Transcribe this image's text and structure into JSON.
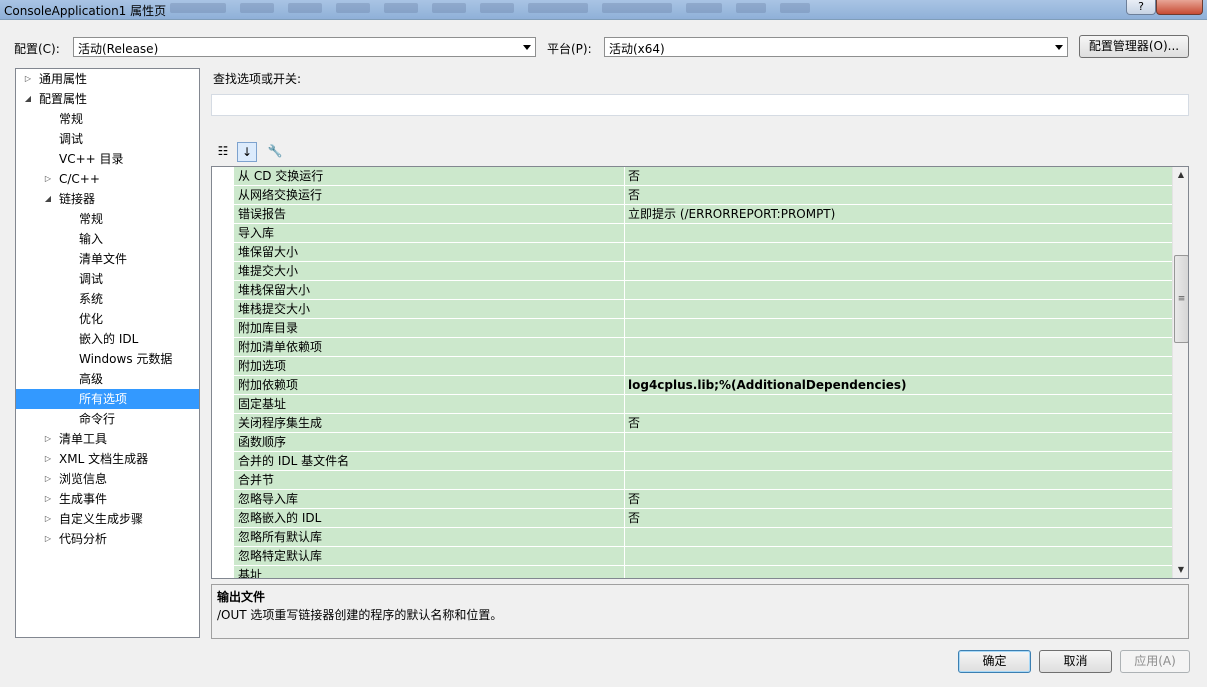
{
  "window": {
    "title": "ConsoleApplication1 属性页",
    "help_label": "?"
  },
  "config": {
    "config_label": "配置(C):",
    "config_value": "活动(Release)",
    "platform_label": "平台(P):",
    "platform_value": "活动(x64)",
    "manager_label": "配置管理器(O)..."
  },
  "tree": {
    "items": [
      {
        "label": "通用属性",
        "expander": "▷"
      },
      {
        "label": "配置属性",
        "expander": "◢"
      },
      {
        "label": "常规",
        "expander": ""
      },
      {
        "label": "调试",
        "expander": ""
      },
      {
        "label": "VC++ 目录",
        "expander": ""
      },
      {
        "label": "C/C++",
        "expander": "▷"
      },
      {
        "label": "链接器",
        "expander": "◢"
      },
      {
        "label": "常规",
        "expander": ""
      },
      {
        "label": "输入",
        "expander": ""
      },
      {
        "label": "清单文件",
        "expander": ""
      },
      {
        "label": "调试",
        "expander": ""
      },
      {
        "label": "系统",
        "expander": ""
      },
      {
        "label": "优化",
        "expander": ""
      },
      {
        "label": "嵌入的 IDL",
        "expander": ""
      },
      {
        "label": "Windows 元数据",
        "expander": ""
      },
      {
        "label": "高级",
        "expander": ""
      },
      {
        "label": "所有选项",
        "expander": ""
      },
      {
        "label": "命令行",
        "expander": ""
      },
      {
        "label": "清单工具",
        "expander": "▷"
      },
      {
        "label": "XML 文档生成器",
        "expander": "▷"
      },
      {
        "label": "浏览信息",
        "expander": "▷"
      },
      {
        "label": "生成事件",
        "expander": "▷"
      },
      {
        "label": "自定义生成步骤",
        "expander": "▷"
      },
      {
        "label": "代码分析",
        "expander": "▷"
      }
    ]
  },
  "search": {
    "label": "查找选项或开关:",
    "value": ""
  },
  "toolbar": {
    "categorized_glyph": "☷",
    "alphabetical_glyph": "↓",
    "pages_glyph": "🔧"
  },
  "grid": {
    "rows": [
      {
        "name": "从 CD 交换运行",
        "value": "否"
      },
      {
        "name": "从网络交换运行",
        "value": "否"
      },
      {
        "name": "错误报告",
        "value": "立即提示 (/ERRORREPORT:PROMPT)"
      },
      {
        "name": "导入库",
        "value": ""
      },
      {
        "name": "堆保留大小",
        "value": ""
      },
      {
        "name": "堆提交大小",
        "value": ""
      },
      {
        "name": "堆栈保留大小",
        "value": ""
      },
      {
        "name": "堆栈提交大小",
        "value": ""
      },
      {
        "name": "附加库目录",
        "value": ""
      },
      {
        "name": "附加清单依赖项",
        "value": ""
      },
      {
        "name": "附加选项",
        "value": ""
      },
      {
        "name": "附加依赖项",
        "value": "log4cplus.lib;%(AdditionalDependencies)"
      },
      {
        "name": "固定基址",
        "value": ""
      },
      {
        "name": "关闭程序集生成",
        "value": "否"
      },
      {
        "name": "函数顺序",
        "value": ""
      },
      {
        "name": "合并的 IDL 基文件名",
        "value": ""
      },
      {
        "name": "合并节",
        "value": ""
      },
      {
        "name": "忽略导入库",
        "value": "否"
      },
      {
        "name": "忽略嵌入的 IDL",
        "value": "否"
      },
      {
        "name": "忽略所有默认库",
        "value": ""
      },
      {
        "name": "忽略特定默认库",
        "value": ""
      },
      {
        "name": "基址",
        "value": ""
      }
    ]
  },
  "description": {
    "title": "输出文件",
    "text": "/OUT 选项重写链接器创建的程序的默认名称和位置。"
  },
  "buttons": {
    "ok": "确定",
    "cancel": "取消",
    "apply": "应用(A)"
  },
  "colors": {
    "grid_row": "#cce8cc",
    "selection": "#3399ff"
  }
}
